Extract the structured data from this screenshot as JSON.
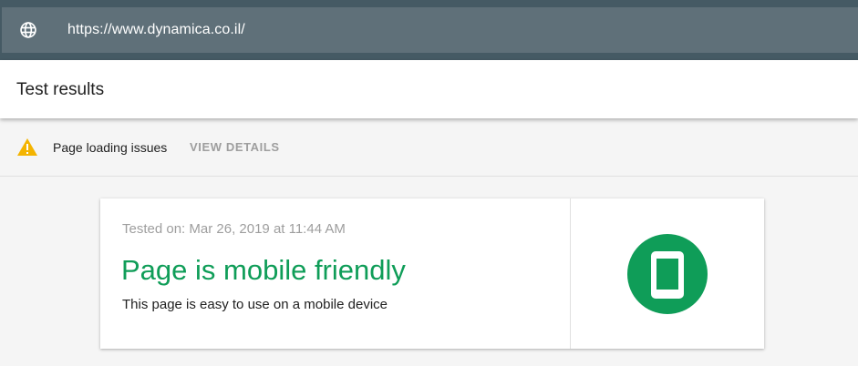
{
  "address_bar": {
    "url": "https://www.dynamica.co.il/",
    "icon": "globe-icon"
  },
  "header": {
    "title": "Test results"
  },
  "issues": {
    "icon": "warning-icon",
    "label": "Page loading issues",
    "action": "VIEW DETAILS"
  },
  "result_card": {
    "tested_on": "Tested on: Mar 26, 2019 at 11:44 AM",
    "title": "Page is mobile friendly",
    "description": "This page is easy to use on a mobile device",
    "status_icon": "mobile-phone-icon"
  },
  "colors": {
    "topbar": "#455a64",
    "urlbar": "#5f7079",
    "success_green": "#0f9d58",
    "warning_yellow": "#f4b400",
    "muted_text": "#9e9e9e"
  }
}
